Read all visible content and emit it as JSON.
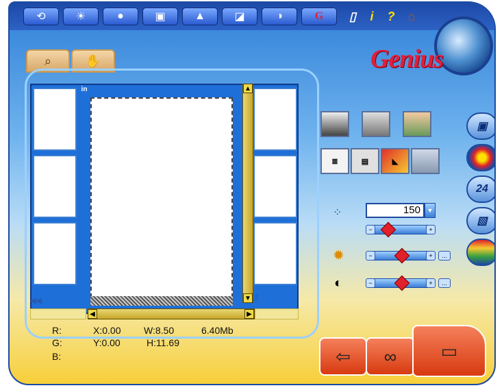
{
  "toolbar": {
    "icons": [
      "scan-refresh-icon",
      "lightbulb-icon",
      "sphere-icon",
      "crop-frame-icon",
      "color-triangle-icon",
      "red-square-icon",
      "contrast-eye-icon",
      "g-letter-icon"
    ],
    "help": [
      "clipboard-icon",
      "info-icon",
      "help-icon",
      "home-icon"
    ],
    "info_label": "i",
    "help_label": "?",
    "g_label": "G"
  },
  "brand": {
    "logo": "Genius"
  },
  "tabs": {
    "zoom": "⌕",
    "hand": "✋"
  },
  "preview": {
    "in_badge": "in"
  },
  "info": {
    "r_label": "R:",
    "g_label": "G:",
    "b_label": "B:",
    "x": "X:0.00",
    "y": "Y:0.00",
    "w": "W:8.50",
    "h": "H:11.69",
    "size": "6.40Mb"
  },
  "controls": {
    "dpi_value": "150",
    "dpi_drop": "▼",
    "minus": "−",
    "plus": "+",
    "more": "..."
  },
  "side": {
    "dpi_badge": "24"
  },
  "bottom": {
    "exit": "⇦",
    "preview": "∞",
    "scan": "▭"
  },
  "colors": {
    "accent": "#e0203a",
    "frame": "#1b4aa0",
    "slider_knob": "#e0202a"
  }
}
